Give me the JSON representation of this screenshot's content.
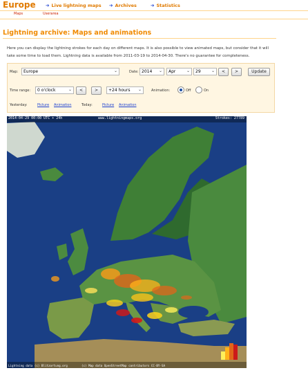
{
  "header": {
    "title": "Europe",
    "nav": [
      {
        "label": "Live lightning maps"
      },
      {
        "label": "Archives"
      },
      {
        "label": "Statistics"
      }
    ],
    "tabs": [
      {
        "label": "Maps"
      },
      {
        "label": "Userarea"
      }
    ]
  },
  "page": {
    "heading": "Lightning archive: Maps and animations",
    "intro": "Here you can display the lightning strokes for each day on different maps. It is also possible to view animated maps, but consider that it will take some time to load them. Lightning data is available from 2011-03-19 to 2014-04-30. There's no guarantee for completeness."
  },
  "form": {
    "map_label": "Map:",
    "map_value": "Europe",
    "date_label": "Date:",
    "year": "2014",
    "month": "Apr",
    "day": "29",
    "prev": "<",
    "next": ">",
    "update": "Update",
    "time_label": "Time range:",
    "time_value": "0 o'clock",
    "range_value": "+24 hours",
    "animation_label": "Animation:",
    "anim_off": "Off",
    "anim_on": "On",
    "animation_selected": "Off",
    "yesterday_label": "Yesterday:",
    "today_label": "Today:",
    "picture": "Picture",
    "animation": "Animation"
  },
  "map": {
    "timestamp": "2014-04-29 00:00 UTC + 24h",
    "site": "www.lightningmaps.org",
    "strokes": "Strokes: 27789",
    "footer_left": "Lightning data (c) Blitzortung.org",
    "footer_right": "(c) Map data OpenStreetMap contributors CC-BY-SA"
  },
  "colors": {
    "brand_orange": "#e07a00",
    "link_blue": "#1a3fcf",
    "sea": "#1a3f85",
    "land": "#3f7f36"
  }
}
